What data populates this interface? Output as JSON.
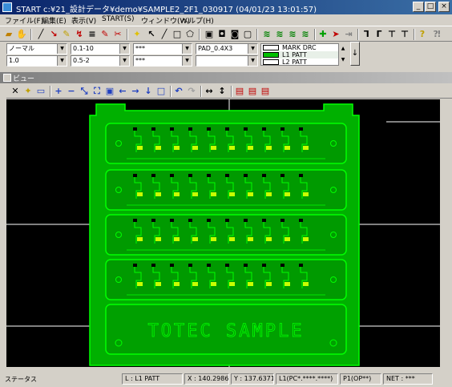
{
  "window": {
    "title": "START c:¥21_設計データ¥demo¥SAMPLE2_2F1_030917 (04/01/23 13:01:57)",
    "btn_min": "_",
    "btn_max": "□",
    "btn_close": "×"
  },
  "menu": [
    "ファイル(F)",
    "編集(E)",
    "表示(V)",
    "START(S)",
    "ウィンドウ(W)",
    "ヘルプ(H)"
  ],
  "combos": {
    "line_type": "ノーマル",
    "width1": "0.1-10",
    "aperture1": "***",
    "pad": "PAD_0.4X3",
    "scale": "1.0",
    "width2": "0.5-2",
    "aperture2": "***",
    "blank": ""
  },
  "layers": [
    {
      "name": "MARK DRC",
      "color": "#ffffff"
    },
    {
      "name": "L1 PATT",
      "color": "#00c000"
    },
    {
      "name": "L2 PATT",
      "color": "#ffffff"
    }
  ],
  "view": {
    "title": "ビュー"
  },
  "board": {
    "silk_text": "TOTEC SAMPLE"
  },
  "status": {
    "label": "ステータス",
    "layer": "L : L1 PATT",
    "x": "X : 140.2986",
    "y": "Y : 137.63711",
    "layer_detail": "L1(PC*.****.****)",
    "page": "P1(OP**)",
    "net": "NET : ***"
  },
  "colors": {
    "pcb_fill": "#00b000",
    "pcb_edge": "#00ff00",
    "bg": "#000000"
  }
}
